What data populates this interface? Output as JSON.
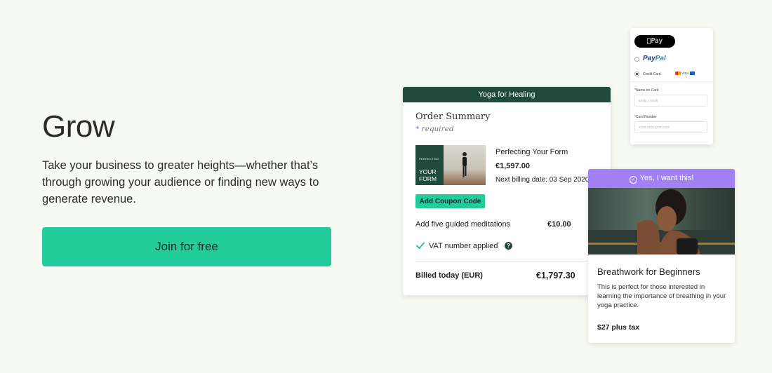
{
  "hero": {
    "title": "Grow",
    "body": "Take your business to greater heights—whether that’s through growing your audience or finding new ways to generate revenue.",
    "cta_label": "Join for free"
  },
  "order": {
    "header": "Yoga for Healing",
    "title": "Order Summary",
    "required_mark": "*",
    "required_text": "required",
    "thumb_small_text": "PERFECTING",
    "thumb_big_text_1": "YOUR",
    "thumb_big_text_2": "FORM",
    "product_name": "Perfecting Your Form",
    "product_price": "€1,597.00",
    "billing_text": "Next billing date: 03 Sep 2020",
    "coupon_label": "Add Coupon Code",
    "addon_label": "Add five guided meditations",
    "addon_price": "€10.00",
    "vat_label": "VAT number applied",
    "help_glyph": "?",
    "billed_label": "Billed today (EUR)",
    "billed_price": "€1,797.30"
  },
  "payment": {
    "applepay_label": "Pay",
    "paypal_pay": "Pay",
    "paypal_pal": "Pal",
    "credit_card_label": "Credit Card",
    "card_brands": "VISA",
    "name_label": "*Name on Card",
    "name_placeholder": "Emily J Smith",
    "card_label": "*Card Number",
    "card_placeholder": "1234 1234 1234 1234"
  },
  "offer": {
    "header": "Yes, I want this!",
    "title": "Breathwork for Beginners",
    "description": "This is perfect for those interested in learning the importance of breathing in your yoga practice.",
    "price": "$27 plus tax"
  },
  "colors": {
    "accent_green": "#22cc9b",
    "dark_green": "#1f4a3c",
    "purple": "#a181f5",
    "background": "#f7f9f4"
  }
}
